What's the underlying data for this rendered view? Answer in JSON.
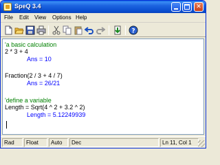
{
  "window": {
    "title": "SpeQ 3.4",
    "icon": "speq-app-icon"
  },
  "menu": {
    "items": [
      "File",
      "Edit",
      "View",
      "Options",
      "Help"
    ]
  },
  "toolbar": {
    "icons": [
      "new-document-icon",
      "open-folder-icon",
      "save-icon",
      "print-icon",
      "cut-icon",
      "copy-icon",
      "paste-icon",
      "undo-icon",
      "redo-icon",
      "calculate-icon",
      "help-icon"
    ]
  },
  "editor": {
    "lines": [
      {
        "text": "'a basic calculation",
        "kind": "comment"
      },
      {
        "text": "2 * 3 + 4",
        "kind": "code"
      },
      {
        "text": "Ans = 10",
        "kind": "answer"
      },
      {
        "text": "",
        "kind": "code"
      },
      {
        "text": "Fraction(2 / 3 + 4 / 7)",
        "kind": "code"
      },
      {
        "text": "Ans = 26/21",
        "kind": "answer"
      },
      {
        "text": "",
        "kind": "code"
      },
      {
        "text": "'define a variable",
        "kind": "comment"
      },
      {
        "text": "Length = Sqrt(4 ^ 2 + 3.2 ^ 2)",
        "kind": "code"
      },
      {
        "text": "Length = 5.12249939",
        "kind": "answer"
      }
    ],
    "colors": {
      "comment": "#008000",
      "code": "#000000",
      "answer": "#0000ff"
    }
  },
  "status": {
    "angle": "Rad",
    "number_format": "Float",
    "mode": "Auto",
    "base": "Dec",
    "position": "Ln 11, Col 1"
  }
}
